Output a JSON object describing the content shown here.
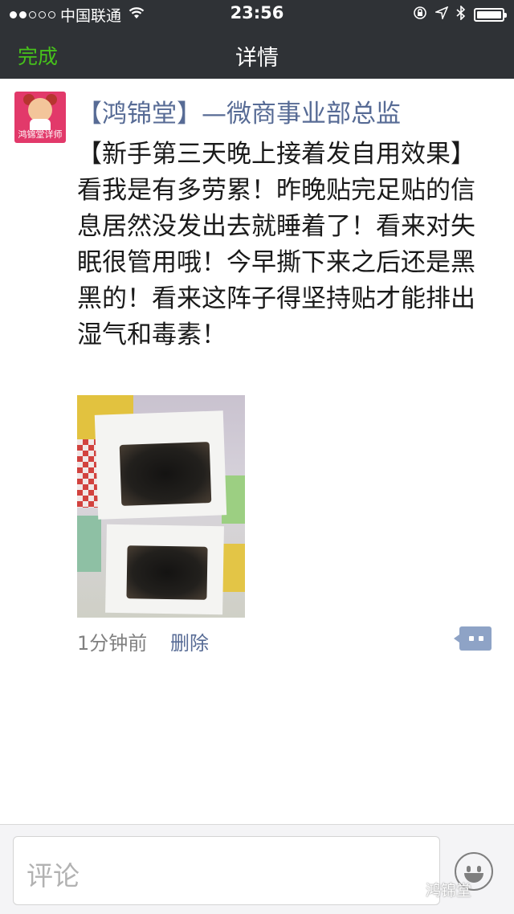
{
  "status_bar": {
    "carrier": "中国联通",
    "time": "23:56",
    "signal_dots": [
      true,
      true,
      false,
      false,
      false
    ]
  },
  "nav": {
    "done_label": "完成",
    "title": "详情"
  },
  "post": {
    "avatar_caption": "鸿锦堂详师",
    "author": "【鸿锦堂】—微商事业部总监",
    "text": "【新手第三天晚上接着发自用效果】看我是有多劳累！昨晚贴完足贴的信息居然没发出去就睡着了！看来对失眠很管用哦！今早撕下来之后还是黑黑的！看来这阵子得坚持贴才能排出湿气和毒素！",
    "time_ago": "1分钟前",
    "delete_label": "删除"
  },
  "comment_bar": {
    "placeholder": "评论"
  },
  "watermark": "鸿锦堂",
  "icons": {
    "wifi": "wifi-icon",
    "lock": "orientation-lock-icon",
    "location": "location-arrow-icon",
    "bluetooth": "bluetooth-icon",
    "battery": "battery-icon",
    "comment": "comment-bubble-icon",
    "emoji": "emoji-icon"
  },
  "colors": {
    "nav_background": "#2f3236",
    "done_green": "#46c11b",
    "link_blue": "#576b95",
    "comment_button": "#8ea3c6"
  }
}
